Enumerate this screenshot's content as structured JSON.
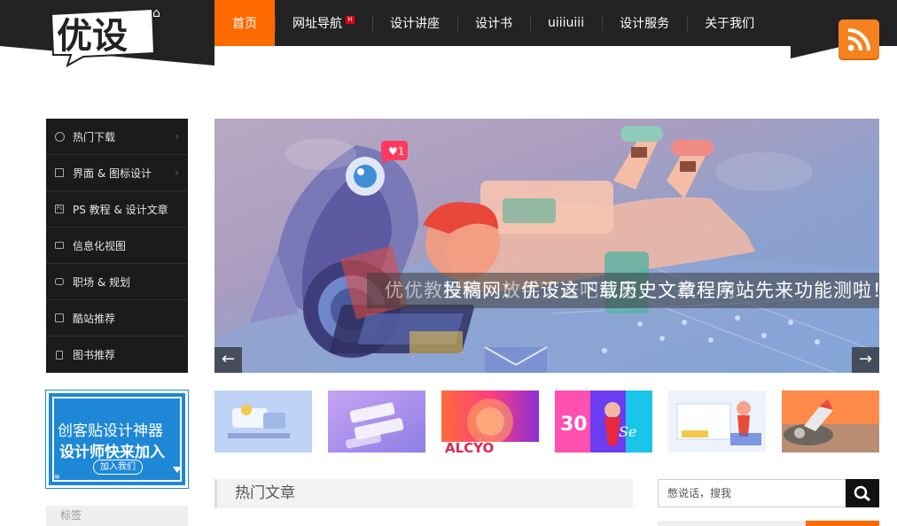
{
  "site": {
    "logo_text": "优设",
    "nav": [
      {
        "label": "首页",
        "active": true
      },
      {
        "label": "网址导航",
        "badge": "H"
      },
      {
        "label": "设计讲座"
      },
      {
        "label": "设计书"
      },
      {
        "label": "uiiiuiii"
      },
      {
        "label": "设计服务"
      },
      {
        "label": "关于我们"
      }
    ],
    "accent_color": "#ff6a00",
    "rss_color": "#f5821f"
  },
  "sidebar": {
    "items": [
      {
        "label": "热门下载",
        "icon": "download-circle-icon",
        "has_arrow": true
      },
      {
        "label": "界面 & 图标设计",
        "icon": "layout-icon",
        "has_arrow": true
      },
      {
        "label": "PS 教程 & 设计文章",
        "icon": "ps-icon",
        "has_arrow": false
      },
      {
        "label": "信息化视图",
        "icon": "monitor-icon",
        "has_arrow": false
      },
      {
        "label": "职场 & 规划",
        "icon": "chat-icon",
        "has_arrow": false
      },
      {
        "label": "酷站推荐",
        "icon": "page-icon",
        "has_arrow": false
      },
      {
        "label": "图书推荐",
        "icon": "book-icon",
        "has_arrow": false
      }
    ]
  },
  "ad": {
    "line1": "创客贴设计神器",
    "line2": "设计师快来加入",
    "button": "加入我们"
  },
  "tags": {
    "title": "标签"
  },
  "slider": {
    "caption": "投稿网：优设这下载历史文章程序站先来功能测啦！",
    "caption_ghost": "优优教程网：放手下去吧原来史文教程网"
  },
  "hot": {
    "title": "热门文章"
  },
  "search": {
    "placeholder": "憋说话，搜我"
  }
}
